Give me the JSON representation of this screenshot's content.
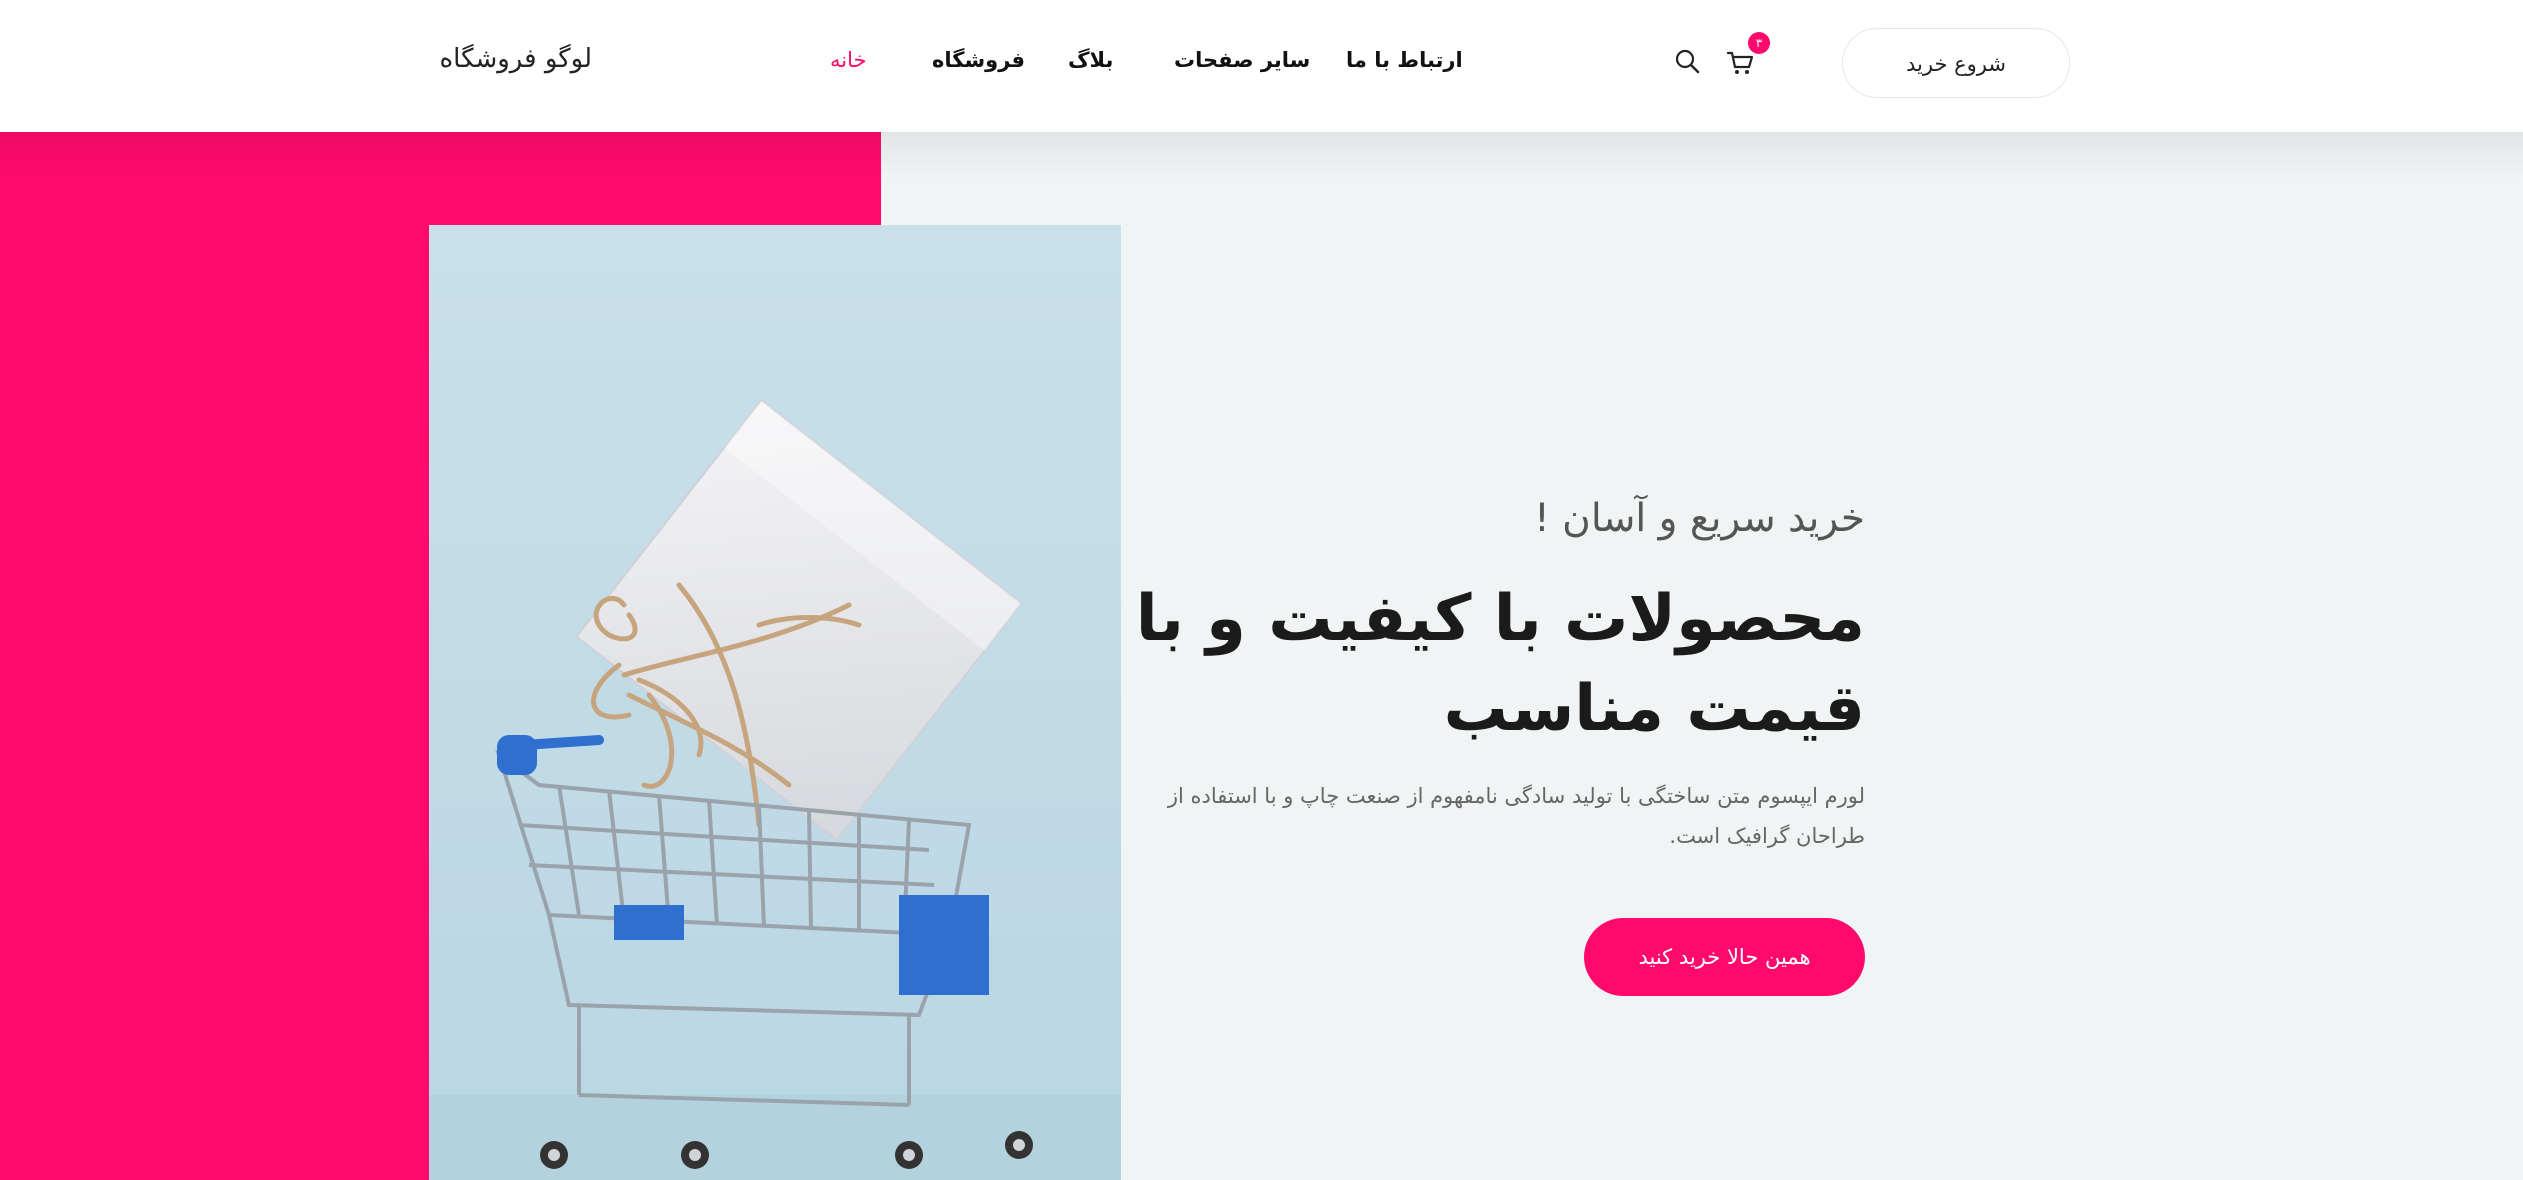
{
  "header": {
    "logo_text": "لوگو فروشگاه",
    "nav": {
      "home": "خانه",
      "shop": "فروشگاه",
      "blog": "بلاگ",
      "other_pages": "سایر صفحات",
      "contact": "ارتباط با ما"
    },
    "cart_count": "۳",
    "start_shopping": "شروع خرید",
    "icons": {
      "search": "search-icon",
      "cart": "cart-icon"
    }
  },
  "hero": {
    "subtitle": "خرید سریع و آسان !",
    "title": "محصولات با کیفیت و با قیمت مناسب",
    "description": "لورم ایپسوم متن ساختگی با تولید سادگی نامفهوم از صنعت چاپ و با استفاده از طراحان گرافیک است.",
    "cta": "همین حالا خرید کنید"
  },
  "colors": {
    "accent": "#ff0a6c",
    "hero_background": "#f0f4f5",
    "photo_background": "#c7dfe9",
    "cart_blue": "#2f6fd0"
  }
}
